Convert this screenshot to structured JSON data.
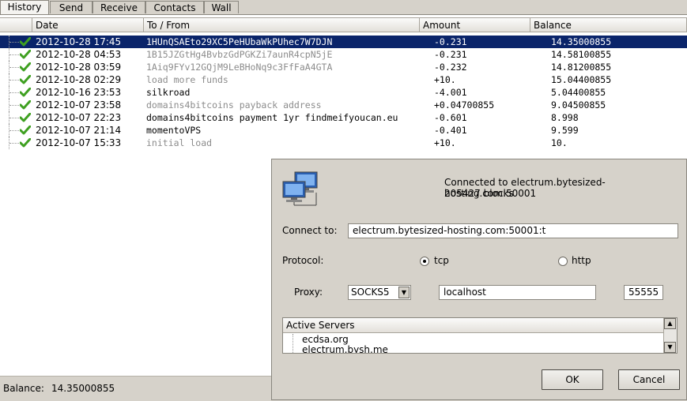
{
  "tabs": [
    {
      "label": "History"
    },
    {
      "label": "Send"
    },
    {
      "label": "Receive"
    },
    {
      "label": "Contacts"
    },
    {
      "label": "Wall"
    }
  ],
  "history": {
    "columns": {
      "date": "Date",
      "to_from": "To / From",
      "amount": "Amount",
      "balance": "Balance"
    },
    "rows": [
      {
        "date": "2012-10-28 17:45",
        "to_from": "1HUnQSAEto29XC5PeHUbaWkPUhec7W7DJN",
        "amount": "-0.231",
        "balance": "14.35000855"
      },
      {
        "date": "2012-10-28 04:53",
        "to_from": "1B15JZGtHg4BvbzGdPGKZi7aunR4cpN5jE",
        "amount": "-0.231",
        "balance": "14.58100855"
      },
      {
        "date": "2012-10-28 03:59",
        "to_from": "1Aiq9FYv12GQjM9LeBHoNq9c3FfFaA4GTA",
        "amount": "-0.232",
        "balance": "14.81200855"
      },
      {
        "date": "2012-10-28 02:29",
        "to_from": "load more funds",
        "amount": "+10.",
        "balance": "15.04400855"
      },
      {
        "date": "2012-10-16 23:53",
        "to_from": "silkroad",
        "amount": "-4.001",
        "balance": "5.04400855"
      },
      {
        "date": "2012-10-07 23:58",
        "to_from": "domains4bitcoins payback address",
        "amount": "+0.04700855",
        "balance": "9.04500855"
      },
      {
        "date": "2012-10-07 22:23",
        "to_from": "domains4bitcoins payment 1yr findmeifyoucan.eu",
        "amount": "-0.601",
        "balance": "8.998"
      },
      {
        "date": "2012-10-07 21:14",
        "to_from": "momentoVPS",
        "amount": "-0.401",
        "balance": "9.599"
      },
      {
        "date": "2012-10-07 15:33",
        "to_from": "initial load",
        "amount": "+10.",
        "balance": "10."
      }
    ]
  },
  "status": {
    "label": "Balance:",
    "value": "14.35000855"
  },
  "dialog": {
    "status_line1": "Connected to electrum.bytesized-hosting.com:50001",
    "status_line2": "205427 blocks",
    "connect_label": "Connect to:",
    "connect_value": "electrum.bytesized-hosting.com:50001:t",
    "protocol_label": "Protocol:",
    "protocol_tcp": "tcp",
    "protocol_http": "http",
    "proxy_label": "Proxy:",
    "proxy_type": "SOCKS5",
    "proxy_host": "localhost",
    "proxy_port": "55555",
    "servers_header": "Active Servers",
    "servers": [
      "ecdsa.org",
      "electrum.bysh.me"
    ],
    "ok": "OK",
    "cancel": "Cancel"
  },
  "colors": {
    "selection": "#0a246a",
    "window": "#d6d2ca",
    "check": "#3fa021"
  }
}
